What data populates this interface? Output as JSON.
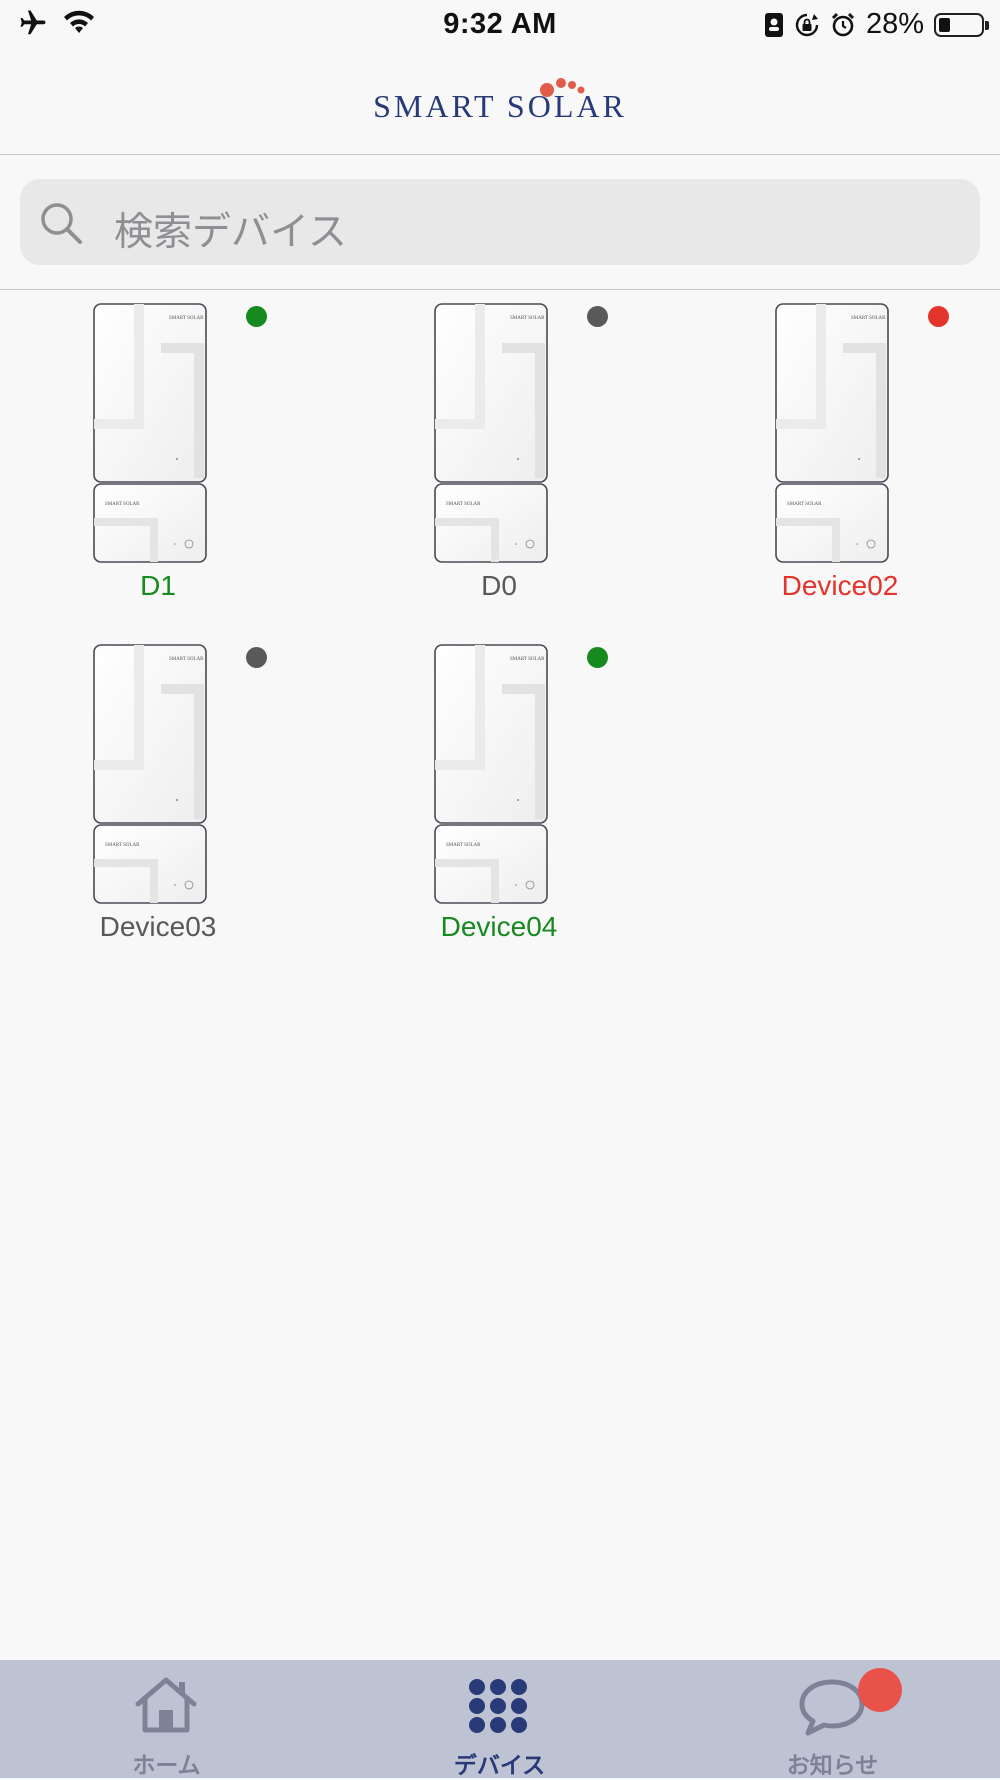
{
  "status_bar": {
    "time": "9:32 AM",
    "battery": "28%",
    "battery_level": 0.28,
    "left_icons": [
      "airplane-icon",
      "wifi-icon"
    ],
    "right_icons": [
      "contact-card-icon",
      "orientation-lock-icon",
      "alarm-icon",
      "battery-icon"
    ]
  },
  "header": {
    "logo_text": "SMART SOLAR",
    "brand_dot_color": "#e25c4a",
    "brand_text_color": "#283a78"
  },
  "search": {
    "placeholder": "検索デバイス",
    "icon": "search-icon"
  },
  "colors": {
    "online": "#178a1f",
    "offline": "#595959",
    "error": "#e3342c"
  },
  "devices": [
    {
      "name": "D1",
      "status": "online",
      "color": "#178a1f"
    },
    {
      "name": "D0",
      "status": "offline",
      "color": "#595959"
    },
    {
      "name": "Device02",
      "status": "error",
      "color": "#e3342c"
    },
    {
      "name": "Device03",
      "status": "offline",
      "color": "#595959"
    },
    {
      "name": "Device04",
      "status": "online",
      "color": "#178a1f"
    }
  ],
  "tabbar": {
    "tabs": [
      {
        "label": "ホーム",
        "icon": "home-icon",
        "active": false
      },
      {
        "label": "デバイス",
        "icon": "grid-dots-icon",
        "active": true
      },
      {
        "label": "お知らせ",
        "icon": "chat-bubble-icon",
        "active": false,
        "badge": true
      }
    ],
    "active_color": "#283a78",
    "inactive_color": "#7d8296",
    "badge_color": "#e9524a"
  }
}
